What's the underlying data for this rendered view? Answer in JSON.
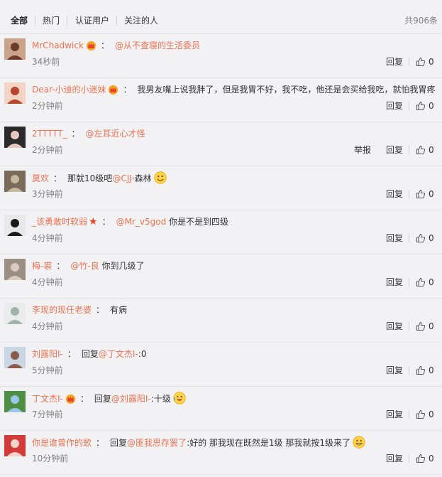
{
  "tabs": [
    "全部",
    "热门",
    "认证用户",
    "关注的人"
  ],
  "total": "共906条",
  "actions": {
    "reply": "回复",
    "report": "举报"
  },
  "colors": {
    "accent": "#eb7350",
    "text": "#333333",
    "muted": "#808080"
  },
  "comments": [
    {
      "user": "MrChadwick",
      "badge": "crown-icon",
      "parts": [
        {
          "t": "mention",
          "v": "@从不查寝的生活委员"
        }
      ],
      "time": "34秒前",
      "likes": "0"
    },
    {
      "user": "Dear-小迪的小迷妹",
      "badge": "crown-icon",
      "parts": [
        {
          "t": "text",
          "v": "我男友嘴上说我胖了，但是我胃不好，我不吃，他还是会买给我吃，就怕我胃疼"
        }
      ],
      "time": "2分钟前",
      "likes": "0"
    },
    {
      "user": "2TTTTT_",
      "badge": "",
      "parts": [
        {
          "t": "mention",
          "v": "@左耳近心才怪"
        }
      ],
      "time": "2分钟前",
      "likes": "0",
      "report": true
    },
    {
      "user": "莫欢",
      "badge": "",
      "parts": [
        {
          "t": "text",
          "v": "那就10级吧"
        },
        {
          "t": "mention",
          "v": "@CJJ"
        },
        {
          "t": "text",
          "v": "·森林"
        }
      ],
      "time": "3分钟前",
      "likes": "0",
      "emoji": "smile-emoji"
    },
    {
      "user": "_该勇敢时软弱",
      "badge": "star-icon",
      "parts": [
        {
          "t": "mention",
          "v": "@Mr_v5god"
        },
        {
          "t": "text",
          "v": " 你是不是到四级"
        }
      ],
      "time": "4分钟前",
      "likes": "0"
    },
    {
      "user": "梅-裘",
      "badge": "",
      "parts": [
        {
          "t": "mention",
          "v": "@竹-良"
        },
        {
          "t": "text",
          "v": " 你到几级了"
        }
      ],
      "time": "4分钟前",
      "likes": "0"
    },
    {
      "user": "李现的现任老婆",
      "badge": "",
      "parts": [
        {
          "t": "text",
          "v": "有病"
        }
      ],
      "time": "4分钟前",
      "likes": "0"
    },
    {
      "user": "刘露阳I-",
      "badge": "",
      "parts": [
        {
          "t": "text",
          "v": "回复"
        },
        {
          "t": "mention",
          "v": "@丁文杰I-"
        },
        {
          "t": "text",
          "v": ":0"
        }
      ],
      "time": "5分钟前",
      "likes": "0"
    },
    {
      "user": "丁文杰I-",
      "badge": "crown-icon",
      "parts": [
        {
          "t": "text",
          "v": "回复"
        },
        {
          "t": "mention",
          "v": "@刘露阳I-"
        },
        {
          "t": "text",
          "v": ":十级"
        }
      ],
      "time": "7分钟前",
      "likes": "0",
      "emoji": "cry-laugh-emoji"
    },
    {
      "user": "你是谁曾作的歌",
      "badge": "",
      "parts": [
        {
          "t": "text",
          "v": "回复"
        },
        {
          "t": "mention",
          "v": "@匪我思存罢了"
        },
        {
          "t": "text",
          "v": ":好的 那我现在既然是1级 那我就按1级来了"
        }
      ],
      "time": "10分钟前",
      "likes": "0",
      "emoji": "grin-emoji"
    }
  ]
}
